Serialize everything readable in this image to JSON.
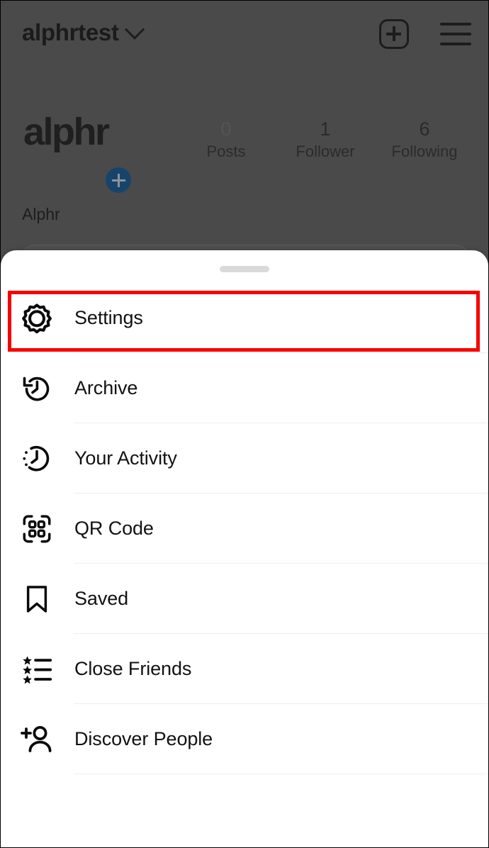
{
  "header": {
    "username": "alphrtest",
    "chevron_icon": "chevron-down-icon",
    "new_post_icon": "plus-square-icon",
    "menu_icon": "hamburger-menu-icon"
  },
  "profile": {
    "avatar_logo_text": "alphr",
    "avatar_add_icon": "plus-circle-icon",
    "display_name": "Alphr",
    "stats": [
      {
        "value": "0",
        "label": "Posts"
      },
      {
        "value": "1",
        "label": "Follower"
      },
      {
        "value": "6",
        "label": "Following"
      }
    ]
  },
  "sheet": {
    "drag_handle": "drag-handle",
    "items": [
      {
        "label": "Settings",
        "icon": "gear-icon"
      },
      {
        "label": "Archive",
        "icon": "clock-rewind-icon"
      },
      {
        "label": "Your Activity",
        "icon": "clock-dotted-icon"
      },
      {
        "label": "QR Code",
        "icon": "qr-code-icon"
      },
      {
        "label": "Saved",
        "icon": "bookmark-icon"
      },
      {
        "label": "Close Friends",
        "icon": "star-list-icon"
      },
      {
        "label": "Discover People",
        "icon": "person-add-icon"
      }
    ]
  },
  "annotation": {
    "highlight_color": "#f80000",
    "highlight_target": "Settings"
  },
  "colors": {
    "overlay": "#4a4a4a",
    "sheet_bg": "#ffffff",
    "text": "#121212",
    "badge_blue": "#17446b",
    "divider": "#eeeeee"
  }
}
